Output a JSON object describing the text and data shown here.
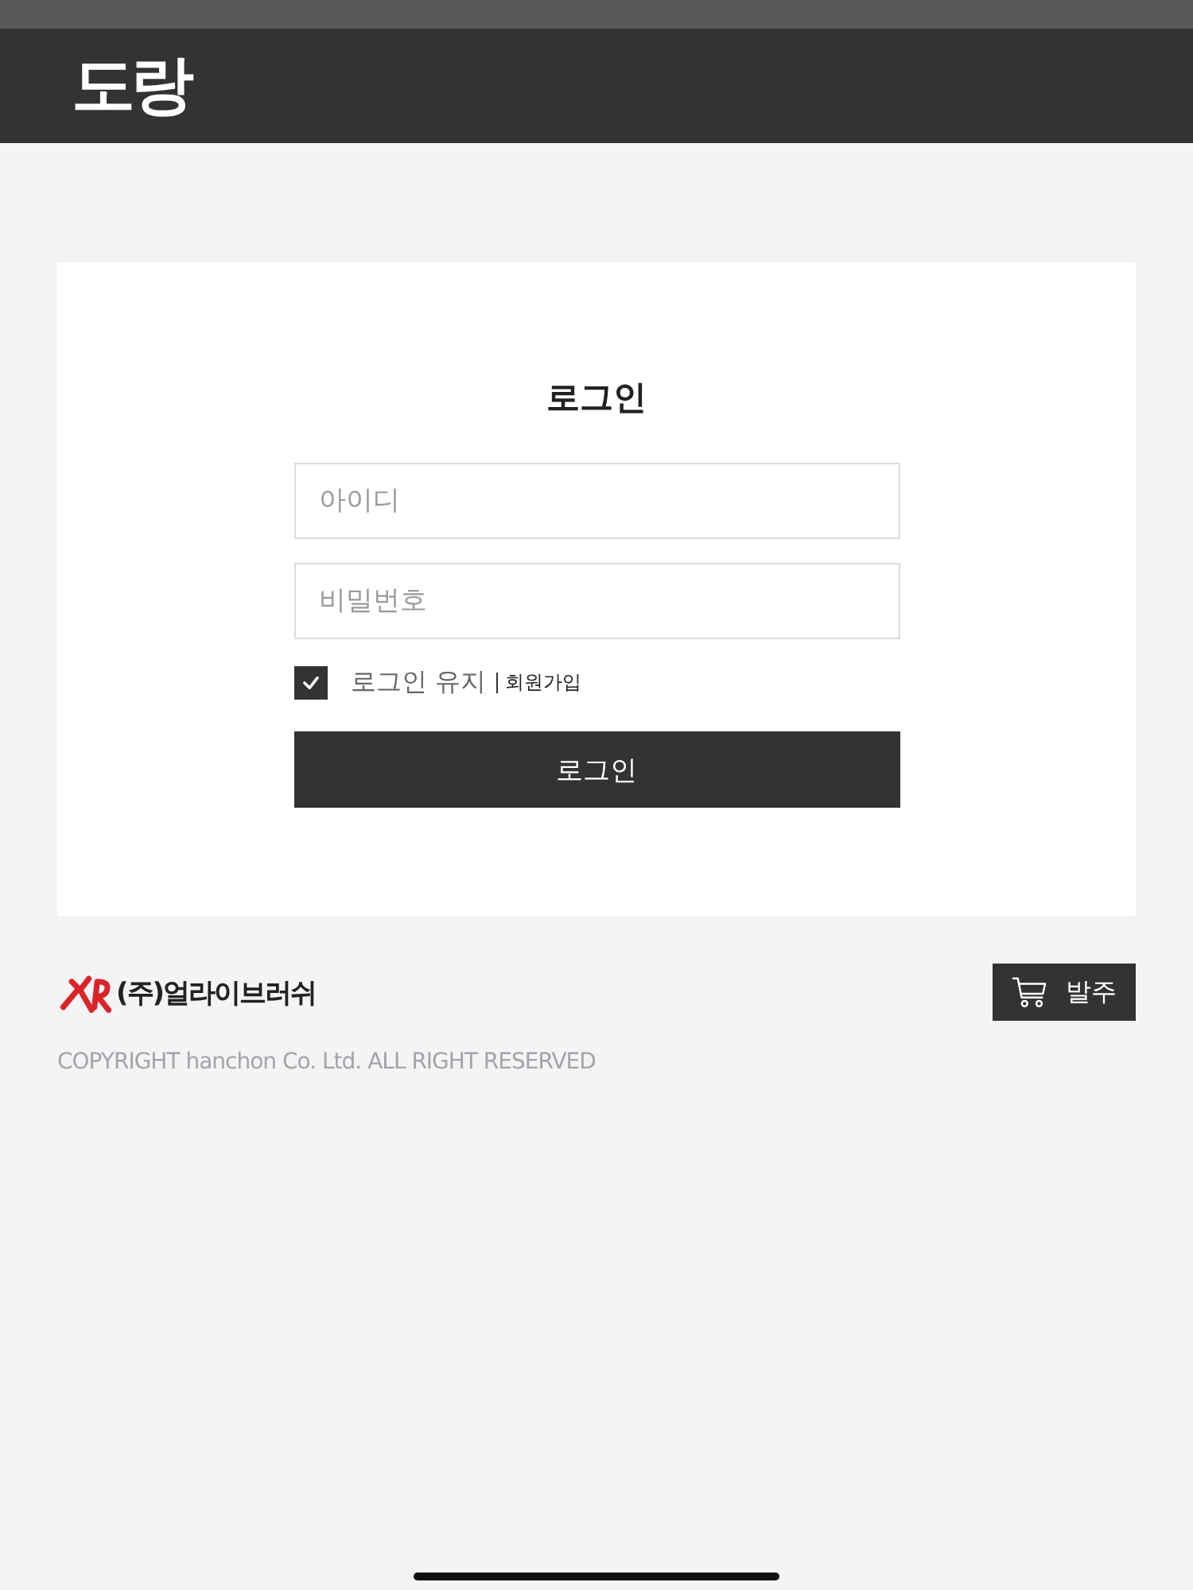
{
  "header": {
    "logo": "도랑"
  },
  "login": {
    "title": "로그인",
    "fields": [
      {
        "placeholder": "아이디"
      },
      {
        "placeholder": "비밀번호"
      }
    ],
    "keep_login": {
      "label": "로그인 유지",
      "checked": true
    },
    "signup_link": "회원가입",
    "submit": "로그인"
  },
  "footer": {
    "company": "(주)얼라이브러쉬",
    "order_button": "발주",
    "copyright": "COPYRIGHT hanchon Co. Ltd. ALL RIGHT RESERVED"
  }
}
